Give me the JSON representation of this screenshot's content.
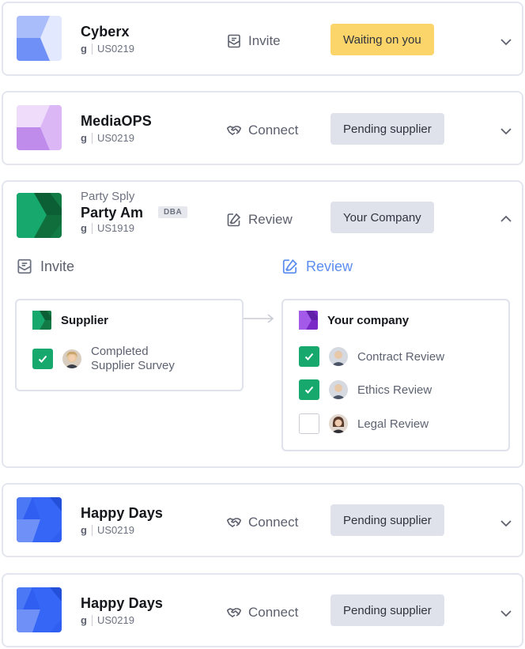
{
  "suppliers": [
    {
      "name": "Cyberx",
      "code_prefix": "g",
      "code": "US0219",
      "action": "Invite",
      "status": "Waiting on you"
    },
    {
      "name": "MediaOPS",
      "code_prefix": "g",
      "code": "US0219",
      "action": "Connect",
      "status": "Pending supplier"
    },
    {
      "legal_name": "Party Sply",
      "name": "Party Am",
      "tag": "DBA",
      "code_prefix": "g",
      "code": "US1919",
      "action": "Review",
      "status": "Your Company"
    },
    {
      "name": "Happy Days",
      "code_prefix": "g",
      "code": "US0219",
      "action": "Connect",
      "status": "Pending supplier"
    },
    {
      "name": "Happy Days",
      "code_prefix": "g",
      "code": "US0219",
      "action": "Connect",
      "status": "Pending supplier"
    }
  ],
  "workflow": {
    "invite_label": "Invite",
    "review_label": "Review",
    "supplier_box": {
      "title": "Supplier",
      "tasks": [
        {
          "label_line1": "Completed",
          "label_line2": "Supplier Survey",
          "done": true
        }
      ]
    },
    "company_box": {
      "title": "Your company",
      "tasks": [
        {
          "label": "Contract Review",
          "done": true
        },
        {
          "label": "Ethics Review",
          "done": true
        },
        {
          "label": "Legal Review",
          "done": false
        }
      ]
    }
  },
  "colors": {
    "waiting": "#fbd46a",
    "pending": "#dfe2ea",
    "check": "#17a86e",
    "review_accent": "#5b8def"
  }
}
